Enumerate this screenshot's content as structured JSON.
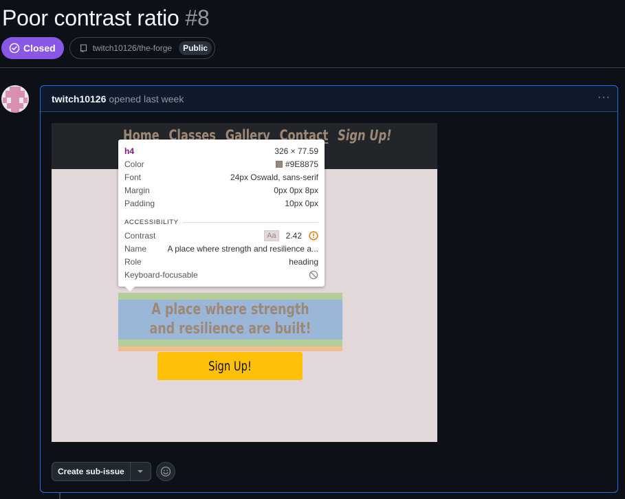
{
  "issue": {
    "title": "Poor contrast ratio",
    "number": "#8",
    "state": "Closed",
    "repo": "twitch10126/the-forge",
    "visibility": "Public"
  },
  "comment": {
    "author": "twitch10126",
    "action": "opened last week"
  },
  "embedded_page": {
    "nav_links": [
      "Home",
      "Classes",
      "Gallery",
      "Contact"
    ],
    "nav_cta": "Sign Up!",
    "heading": "A place where strength and resilience are built!",
    "button": "Sign Up!",
    "colors": {
      "nav_bg": "#22252a",
      "page_bg": "#e2d8d9",
      "text": "#9E8875",
      "button_bg": "#ffc107"
    }
  },
  "tooltip": {
    "tag": "h4",
    "size": "326 × 77.59",
    "rows": [
      {
        "label": "Color",
        "value": "#9E8875"
      },
      {
        "label": "Font",
        "value": "24px Oswald, sans-serif"
      },
      {
        "label": "Margin",
        "value": "0px 0px 8px"
      },
      {
        "label": "Padding",
        "value": "10px 0px"
      }
    ],
    "section": "ACCESSIBILITY",
    "contrast_label": "Contrast",
    "contrast_sample": "Aa",
    "contrast_value": "2.42",
    "name_label": "Name",
    "name_value": "A place where strength and resilience a...",
    "role_label": "Role",
    "role_value": "heading",
    "focus_label": "Keyboard-focusable"
  },
  "actions": {
    "create_sub_issue": "Create sub-issue"
  },
  "theme": {
    "closed_purple": "#8957e5",
    "focus_blue": "#1f6feb"
  }
}
